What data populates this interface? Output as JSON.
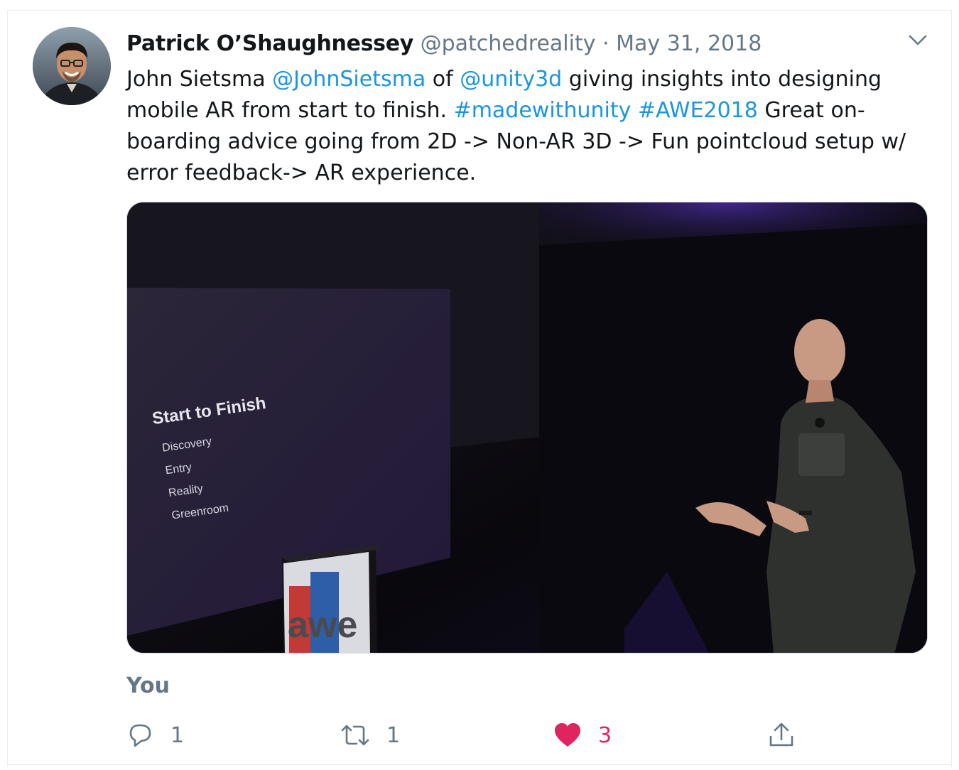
{
  "tweet": {
    "author_name": "Patrick O’Shaughnessey",
    "author_handle": "@patchedreality",
    "separator": "·",
    "date": "May 31, 2018",
    "text_segments": [
      {
        "text": "John Sietsma ",
        "link": false
      },
      {
        "text": "@JohnSietsma",
        "link": true
      },
      {
        "text": " of ",
        "link": false
      },
      {
        "text": "@unity3d",
        "link": true
      },
      {
        "text": " giving insights into designing mobile AR from start to finish. ",
        "link": false
      },
      {
        "text": "#madewithunity",
        "link": true
      },
      {
        "text": " ",
        "link": false
      },
      {
        "text": "#AWE2018",
        "link": true
      },
      {
        "text": " Great on-boarding advice going from 2D -> Non-AR 3D -> Fun pointcloud setup w/ error feedback-> AR experience.",
        "link": false
      }
    ],
    "media": {
      "slide_title": "Start to Finish",
      "slide_items": [
        "Discovery",
        "Entry",
        "Reality",
        "Greenroom"
      ],
      "podium_logo": "awe"
    },
    "context_label": "You",
    "actions": {
      "reply_icon": "reply-icon",
      "reply_count": "1",
      "retweet_icon": "retweet-icon",
      "retweet_count": "1",
      "like_icon": "heart-icon",
      "like_count": "3",
      "share_icon": "share-icon"
    },
    "colors": {
      "link": "#1b95e0",
      "secondary_text": "#657786",
      "like_active": "#e0245e",
      "border": "#e6ecf0"
    }
  }
}
